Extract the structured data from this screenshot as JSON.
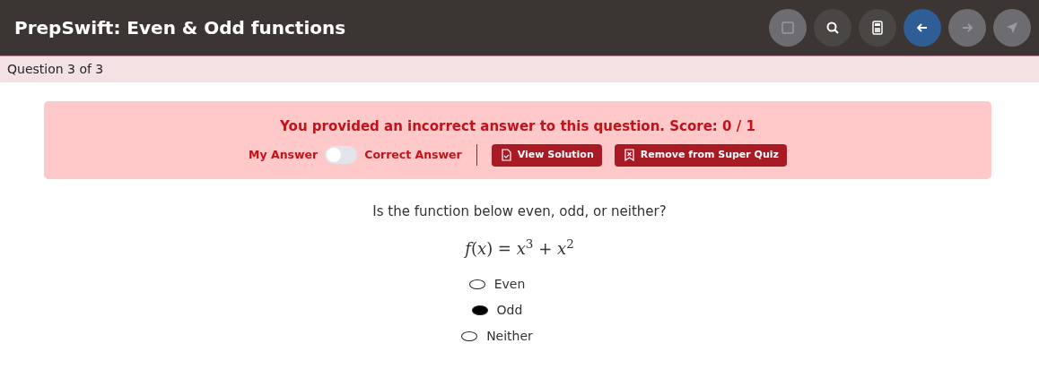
{
  "header": {
    "title": "PrepSwift: Even & Odd functions",
    "toolbar": [
      {
        "kind": "stop",
        "disabled": true,
        "highlighted": false
      },
      {
        "kind": "search",
        "disabled": false,
        "highlighted": false
      },
      {
        "kind": "calculator",
        "disabled": false,
        "highlighted": false
      },
      {
        "kind": "back",
        "disabled": false,
        "highlighted": true
      },
      {
        "kind": "forward",
        "disabled": true,
        "highlighted": false
      },
      {
        "kind": "submit",
        "disabled": true,
        "highlighted": false
      }
    ]
  },
  "progress": "Question 3 of 3",
  "feedback": {
    "message": "You provided an incorrect answer to this question. Score: 0 / 1",
    "toggle": {
      "left_label": "My Answer",
      "right_label": "Correct Answer",
      "on": false
    },
    "buttons": [
      {
        "kind": "solution",
        "label": "View Solution"
      },
      {
        "kind": "remove",
        "label": "Remove from Super Quiz"
      }
    ]
  },
  "question": {
    "prompt": "Is the function below even, odd, or neither?",
    "formula": "*f*(*x*) = *x*$^{3}$ + *x*$^{2}$",
    "options": [
      {
        "label": "Even",
        "selected": false
      },
      {
        "label": "Odd",
        "selected": true
      },
      {
        "label": "Neither",
        "selected": false
      }
    ]
  }
}
